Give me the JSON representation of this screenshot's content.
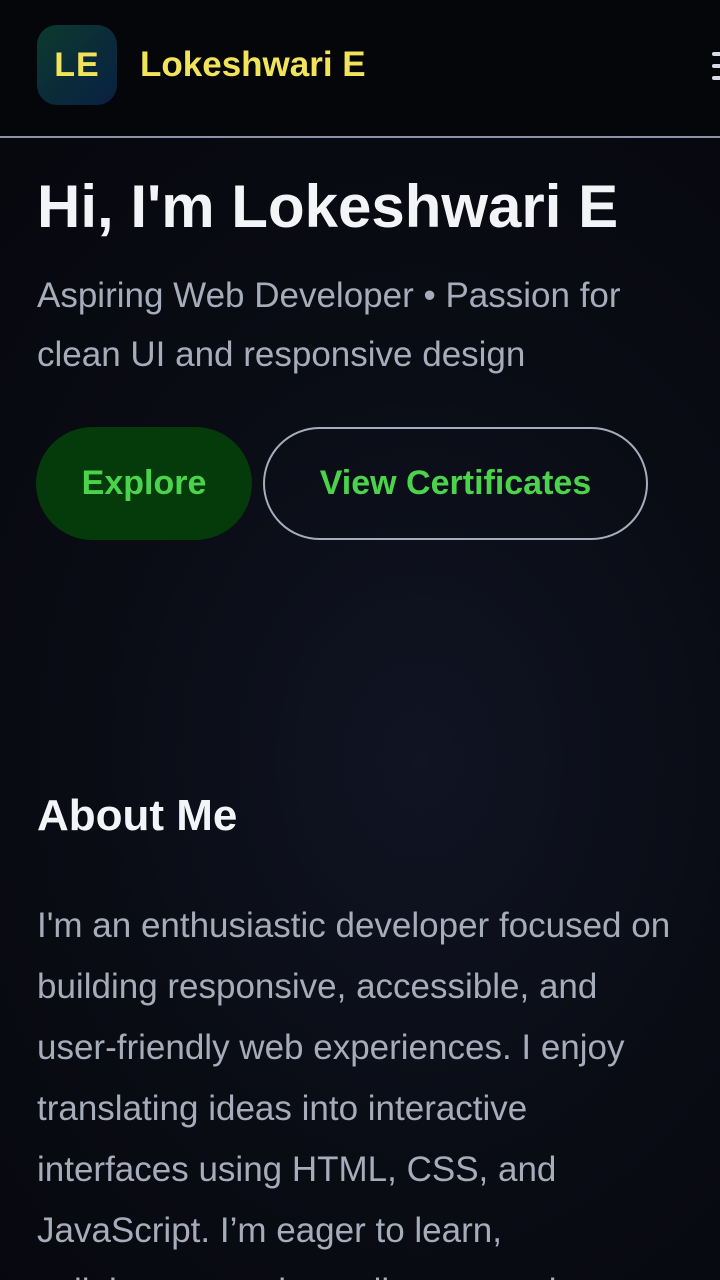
{
  "header": {
    "logo_initials": "LE",
    "brand_name": "Lokeshwari E",
    "menu_icon": "hamburger-menu-icon"
  },
  "hero": {
    "title": "Hi, I'm Lokeshwari E",
    "subtitle": "Aspiring Web Developer • Passion for clean UI and responsive design",
    "primary_button": "Explore",
    "secondary_button": "View Certificates"
  },
  "about": {
    "title": "About Me",
    "lines": [
      "I'm an enthusiastic developer focused on",
      "building responsive, accessible, and",
      "user-friendly web experiences. I enjoy",
      "translating ideas into interactive",
      "interfaces using HTML, CSS, and",
      "JavaScript. I’m eager to learn,",
      "collaborate, and contribute to real"
    ]
  },
  "colors": {
    "accent_yellow": "#f2e45a",
    "accent_green": "#4bd44b",
    "button_green_bg": "#053a0b",
    "background": "#06070c"
  }
}
